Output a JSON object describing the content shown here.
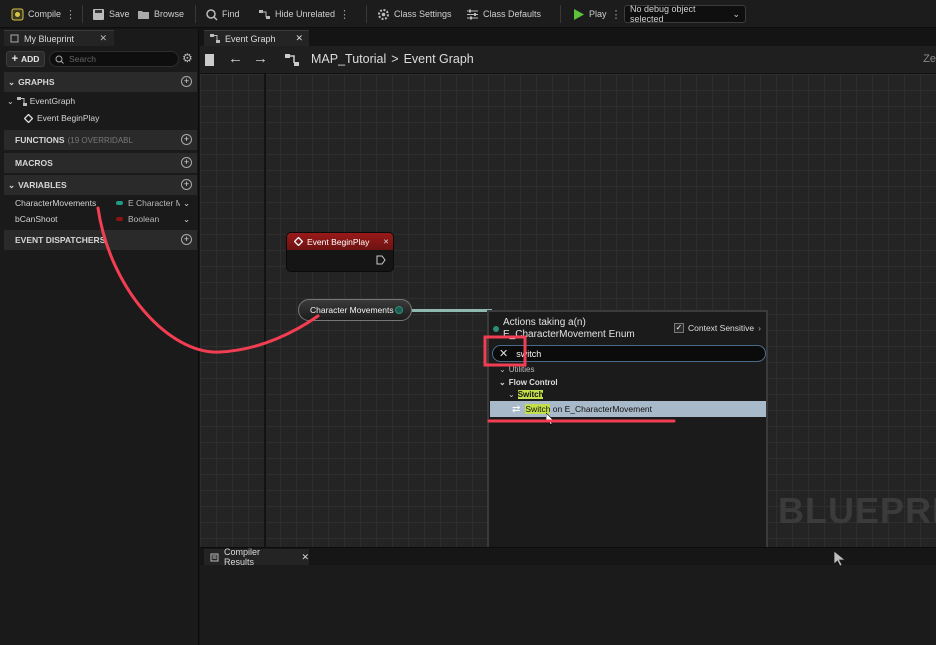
{
  "toolbar": {
    "compile": "Compile",
    "save": "Save",
    "browse": "Browse",
    "find": "Find",
    "hide_unrelated": "Hide Unrelated",
    "class_settings": "Class Settings",
    "class_defaults": "Class Defaults",
    "play": "Play",
    "debug_select": "No debug object selected"
  },
  "left_panel": {
    "tab_title": "My Blueprint",
    "add_label": "ADD",
    "search_placeholder": "Search",
    "graphs_header": "GRAPHS",
    "event_graph": "EventGraph",
    "event_begin_play": "Event BeginPlay",
    "functions_header": "FUNCTIONS",
    "functions_sub": "(19 OVERRIDABL",
    "macros_header": "MACROS",
    "variables_header": "VARIABLES",
    "variables": [
      {
        "name": "CharacterMovements",
        "type": "E Character M",
        "color": "#1f9b86"
      },
      {
        "name": "bCanShoot",
        "type": "Boolean",
        "color": "#8c1414"
      }
    ],
    "event_dispatchers_header": "EVENT DISPATCHERS"
  },
  "graph": {
    "tab_title": "Event Graph",
    "breadcrumb_map": "MAP_Tutorial",
    "breadcrumb_sep": ">",
    "breadcrumb_graph": "Event Graph",
    "zoom_partial": "Ze",
    "watermark": "BLUEPRI"
  },
  "nodes": {
    "begin_play_title": "Event BeginPlay",
    "character_movements": "Character Movements"
  },
  "action_menu": {
    "title": "Actions taking a(n) E_CharacterMovement Enum",
    "context_sensitive": "Context Sensitive",
    "search_value": "switch",
    "utilities": "Utilities",
    "flow_control": "Flow Control",
    "switch_category": "Switch",
    "result_highlight": "Switch",
    "result_rest": " on E_CharacterMovement"
  },
  "compiler": {
    "tab_title": "Compiler Results"
  },
  "colors": {
    "annotation_red": "#f23e52",
    "enum_pin": "#1f9b86",
    "event_header": "#8f1818"
  }
}
